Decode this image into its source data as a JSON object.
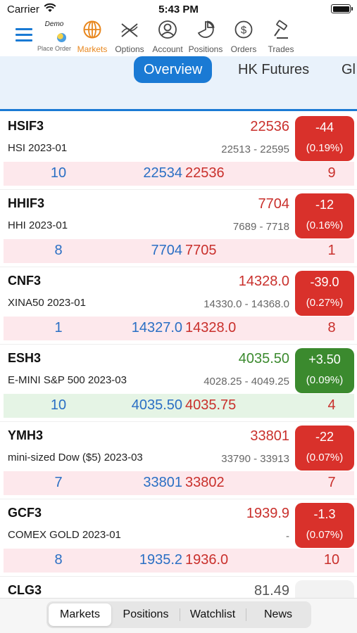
{
  "status": {
    "carrier": "Carrier",
    "time": "5:43 PM"
  },
  "toolbar": {
    "demo_label": "Demo",
    "place_order_label": "Place Order",
    "items": [
      {
        "icon": "globe-icon",
        "label": "Markets",
        "active": true
      },
      {
        "icon": "options-icon",
        "label": "Options"
      },
      {
        "icon": "account-icon",
        "label": "Account"
      },
      {
        "icon": "positions-icon",
        "label": "Positions"
      },
      {
        "icon": "orders-icon",
        "label": "Orders"
      },
      {
        "icon": "trades-icon",
        "label": "Trades"
      }
    ]
  },
  "tabs": [
    "Overview",
    "HK Futures",
    "Gl"
  ],
  "colors": {
    "accent": "#1a7ad4",
    "up": "#3b8a2e",
    "down": "#d9312b",
    "menu_active": "#e8871e"
  },
  "rows": [
    {
      "symbol": "HSIF3",
      "desc": "HSI 2023-01",
      "last": "22536",
      "range": "22513 - 22595",
      "change": "-44",
      "pct": "(0.19%)",
      "bid_qty": "10",
      "bid": "22534",
      "ask": "22536",
      "ask_qty": "9",
      "dir": "down"
    },
    {
      "symbol": "HHIF3",
      "desc": "HHI 2023-01",
      "last": "7704",
      "range": "7689 - 7718",
      "change": "-12",
      "pct": "(0.16%)",
      "bid_qty": "8",
      "bid": "7704",
      "ask": "7705",
      "ask_qty": "1",
      "dir": "down"
    },
    {
      "symbol": "CNF3",
      "desc": "XINA50 2023-01",
      "last": "14328.0",
      "range": "14330.0 - 14368.0",
      "change": "-39.0",
      "pct": "(0.27%)",
      "bid_qty": "1",
      "bid": "14327.0",
      "ask": "14328.0",
      "ask_qty": "8",
      "dir": "down"
    },
    {
      "symbol": "ESH3",
      "desc": "E-MINI S&P 500 2023-03",
      "last": "4035.50",
      "range": "4028.25 - 4049.25",
      "change": "+3.50",
      "pct": "(0.09%)",
      "bid_qty": "10",
      "bid": "4035.50",
      "ask": "4035.75",
      "ask_qty": "4",
      "dir": "up"
    },
    {
      "symbol": "YMH3",
      "desc": "mini-sized Dow ($5) 2023-03",
      "last": "33801",
      "range": "33790 - 33913",
      "change": "-22",
      "pct": "(0.07%)",
      "bid_qty": "7",
      "bid": "33801",
      "ask": "33802",
      "ask_qty": "7",
      "dir": "down"
    },
    {
      "symbol": "GCF3",
      "desc": "COMEX GOLD 2023-01",
      "last": "1939.9",
      "range": "-",
      "change": "-1.3",
      "pct": "(0.07%)",
      "bid_qty": "8",
      "bid": "1935.2",
      "ask": "1936.0",
      "ask_qty": "10",
      "dir": "down"
    },
    {
      "symbol": "CLG3",
      "desc": "",
      "last": "81.49",
      "range": "",
      "change": "",
      "pct": "",
      "bid_qty": "",
      "bid": "",
      "ask": "",
      "ask_qty": "",
      "dir": "neutral"
    }
  ],
  "bottom_tabs": [
    {
      "label": "Markets",
      "active": true
    },
    {
      "label": "Positions"
    },
    {
      "label": "Watchlist"
    },
    {
      "label": "News"
    }
  ]
}
